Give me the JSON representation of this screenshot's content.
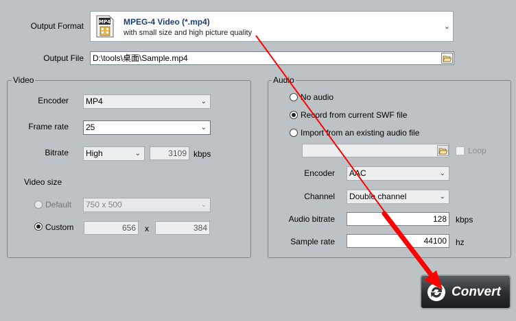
{
  "output_format": {
    "label": "Output Format",
    "icon_text": "MP4",
    "title": "MPEG-4 Video (*.mp4)",
    "subtitle": "with small size and high picture quality"
  },
  "output_file": {
    "label": "Output File",
    "value": "D:\\tools\\桌面\\Sample.mp4"
  },
  "video": {
    "group_title": "Video",
    "encoder_label": "Encoder",
    "encoder_value": "MP4",
    "frame_rate_label": "Frame rate",
    "frame_rate_value": "25",
    "bitrate_label": "Bitrate",
    "bitrate_quality": "High",
    "bitrate_value": "3109",
    "bitrate_unit": "kbps",
    "video_size_label": "Video size",
    "default_label": "Default",
    "default_size": "750 x 500",
    "custom_label": "Custom",
    "custom_width": "656",
    "times": "x",
    "custom_height": "384"
  },
  "audio": {
    "group_title": "Audio",
    "no_audio_label": "No audio",
    "record_label": "Record from current SWF file",
    "import_label": "Import from an existing audio file",
    "import_path": "",
    "loop_label": "Loop",
    "encoder_label": "Encoder",
    "encoder_value": "AAC",
    "channel_label": "Channel",
    "channel_value": "Double channel",
    "bitrate_label": "Audio bitrate",
    "bitrate_value": "128",
    "bitrate_unit": "kbps",
    "sample_rate_label": "Sample rate",
    "sample_rate_value": "44100",
    "sample_rate_unit": "hz"
  },
  "convert": {
    "label": "Convert"
  },
  "colors": {
    "background": "#bcc2c6",
    "annotation_arrow": "#ff0000",
    "title_blue": "#1d3f78"
  }
}
